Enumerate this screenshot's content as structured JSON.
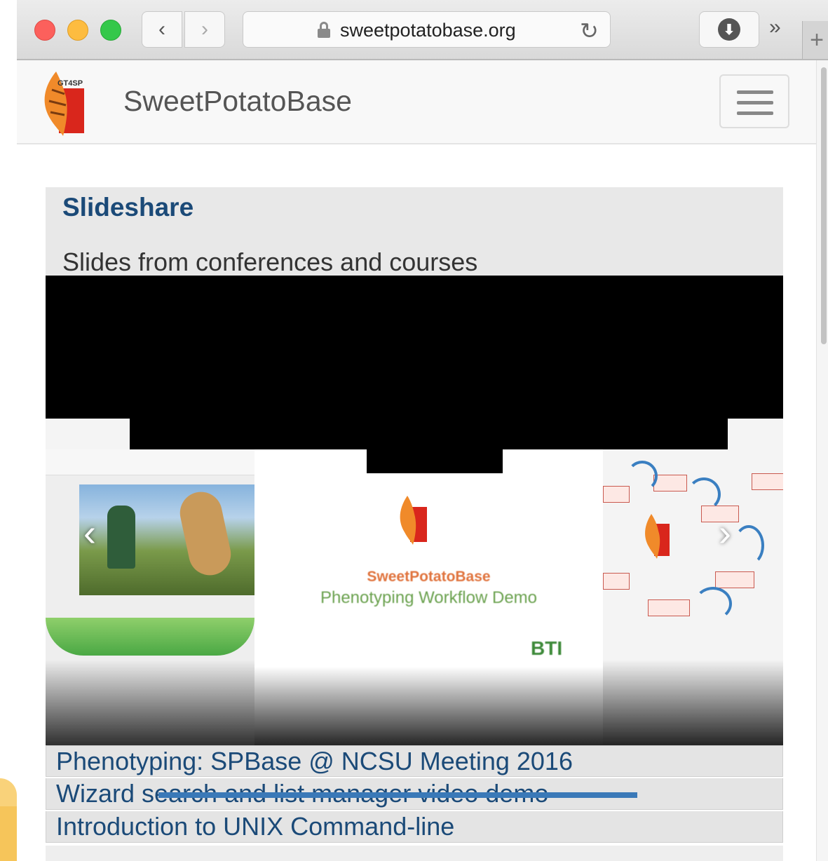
{
  "browser": {
    "url": "sweetpotatobase.org",
    "back_glyph": "‹",
    "forward_glyph": "›",
    "reload_glyph": "↻",
    "download_glyph": "⬇",
    "more_glyph": "»",
    "newtab_glyph": "+"
  },
  "site": {
    "brand": "SweetPotatoBase",
    "logo_text": "GT4SP"
  },
  "slideshare": {
    "title": "Slideshare",
    "subtitle": "Slides from conferences and courses",
    "carousel": {
      "prev_glyph": "‹",
      "next_glyph": "›",
      "current_slide": {
        "title_line1": "SweetPotatoBase",
        "title_line2": "Phenotyping Workflow Demo",
        "badge": "BTI"
      }
    },
    "items": [
      "Phenotyping: SPBase @ NCSU Meeting 2016",
      "Wizard search and list manager video demo",
      "Introduction to UNIX Command-line"
    ]
  },
  "colors": {
    "heading_blue": "#1b4a78",
    "progress_blue": "#3a79b8",
    "logo_orange": "#f08a2a",
    "logo_red": "#d9261c"
  }
}
